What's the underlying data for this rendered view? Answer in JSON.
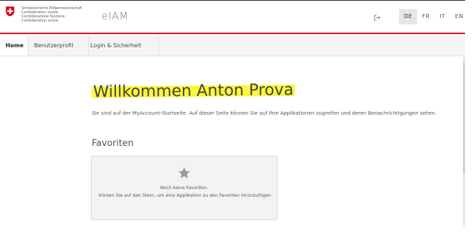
{
  "header": {
    "confederation_lines": [
      "Schweizerische Eidgenossenschaft",
      "Confédération suisse",
      "Confederazione Svizzera",
      "Confederaziun svizra"
    ],
    "app_name": "eIAM",
    "logout_icon": "logout-icon",
    "languages": [
      {
        "code": "DE",
        "active": true
      },
      {
        "code": "FR",
        "active": false
      },
      {
        "code": "IT",
        "active": false
      },
      {
        "code": "EN",
        "active": false
      }
    ],
    "accent_color": "#dc0018"
  },
  "nav": {
    "tabs": [
      {
        "label": "Home",
        "active": true
      },
      {
        "label": "Benutzerprofil",
        "active": false
      },
      {
        "label": "Login & Sicherheit",
        "active": false
      }
    ]
  },
  "main": {
    "welcome": "Willkommen Anton Prova",
    "intro": "Sie sind auf der MyAccount-Startseite. Auf dieser Seite können Sie auf Ihre Applikationen zugreifen und deren Benachrichtigungen sehen.",
    "favorites_title": "Favoriten",
    "favorites_icon": "star-icon",
    "favorites_empty": "Noch keine Favoriten.",
    "favorites_hint": "Klicken Sie auf den Stern, um eine Applikation zu den Favoriten hinzuzufügen",
    "highlight_color": "#fbf73a"
  }
}
